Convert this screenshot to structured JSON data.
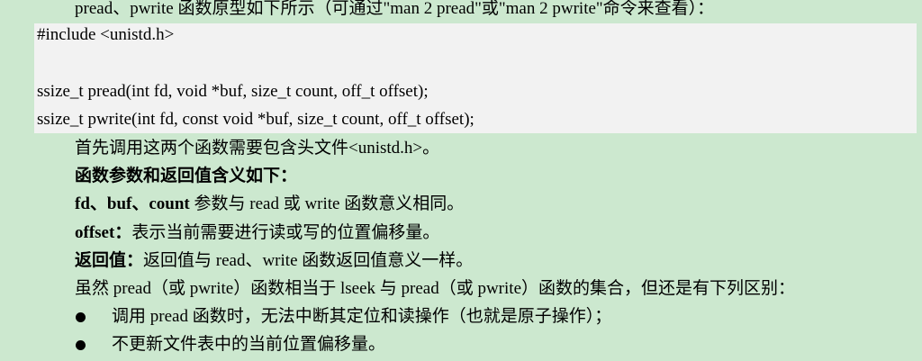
{
  "intro": "pread、pwrite 函数原型如下所示（可通过\"man 2 pread\"或\"man 2 pwrite\"命令来查看）：",
  "code": {
    "include": "#include <unistd.h>",
    "pread_proto": "ssize_t pread(int fd, void *buf, size_t count, off_t offset);",
    "pwrite_proto": "ssize_t pwrite(int fd, const void *buf, size_t count, off_t offset);"
  },
  "paragraphs": {
    "header_note": "首先调用这两个函数需要包含头文件<unistd.h>。",
    "params_heading": "函数参数和返回值含义如下：",
    "fd_term": "fd、buf、count",
    "fd_desc": " 参数与 read 或 write 函数意义相同。",
    "offset_term": "offset：",
    "offset_desc": "表示当前需要进行读或写的位置偏移量。",
    "retval_term": "返回值：",
    "retval_desc": "返回值与 read、write 函数返回值意义一样。",
    "diff_intro": "虽然 pread（或 pwrite）函数相当于 lseek 与 pread（或 pwrite）函数的集合，但还是有下列区别："
  },
  "bullets": [
    "调用 pread 函数时，无法中断其定位和读操作（也就是原子操作）；",
    "不更新文件表中的当前位置偏移量。"
  ]
}
